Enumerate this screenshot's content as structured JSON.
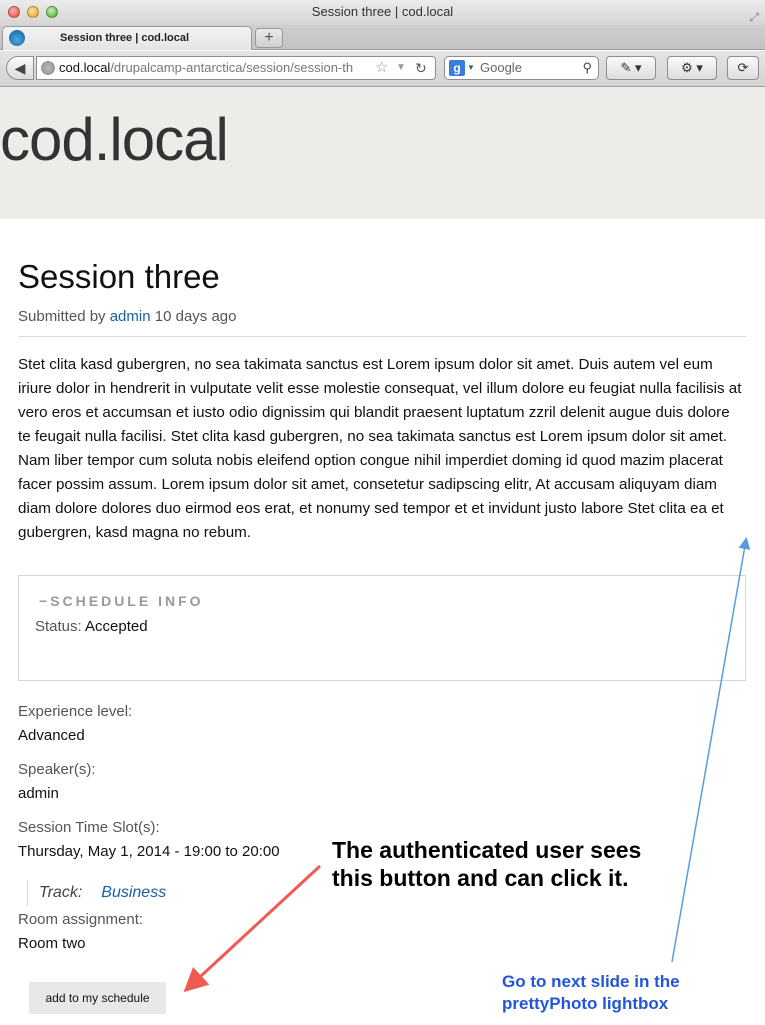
{
  "window": {
    "title": "Session three | cod.local"
  },
  "tab": {
    "title": "Session three | cod.local",
    "new_tab_label": "+"
  },
  "toolbar": {
    "back_label": "◀",
    "url_host": "cod.local",
    "url_path": "/drupalcamp-antarctica/session/session-th",
    "search_placeholder": "Google"
  },
  "site": {
    "name": "cod.local"
  },
  "node": {
    "title": "Session three",
    "submitted_prefix": "Submitted by",
    "author": "admin",
    "submitted_suffix": "10 days ago",
    "body": "Stet clita kasd gubergren, no sea takimata sanctus est Lorem ipsum dolor sit amet. Duis autem vel eum iriure dolor in hendrerit in vulputate velit esse molestie consequat, vel illum dolore eu feugiat nulla facilisis at vero eros et accumsan et iusto odio dignissim qui blandit praesent luptatum zzril delenit augue duis dolore te feugait nulla facilisi. Stet clita kasd gubergren, no sea takimata sanctus est Lorem ipsum dolor sit amet. Nam liber tempor cum soluta nobis eleifend option congue nihil imperdiet doming id quod mazim placerat facer possim assum. Lorem ipsum dolor sit amet, consetetur sadipscing elitr, At accusam aliquyam diam diam dolore dolores duo eirmod eos erat, et nonumy sed tempor et et invidunt justo labore Stet clita ea et gubergren, kasd magna no rebum."
  },
  "schedule": {
    "legend": "SCHEDULE INFO",
    "collapse_glyph": "−",
    "status_label": "Status:",
    "status_value": "Accepted"
  },
  "fields": {
    "experience_label": "Experience level:",
    "experience_value": "Advanced",
    "speakers_label": "Speaker(s):",
    "speakers_value": "admin",
    "timeslot_label": "Session Time Slot(s):",
    "timeslot_value": "Thursday, May 1, 2014 - 19:00 to 20:00",
    "track_label": "Track:",
    "track_value": "Business",
    "room_label": "Room assignment:",
    "room_value": "Room two"
  },
  "actions": {
    "add_to_schedule": "add to my schedule"
  },
  "annotations": {
    "note_line1": "The authenticated user sees",
    "note_line2": "this button and can click it.",
    "next_line1": "Go to next slide in the",
    "next_line2": "prettyPhoto lightbox"
  },
  "colors": {
    "link": "#1a5fa8",
    "arrow_red": "#f05a50",
    "arrow_blue": "#5b9ae0",
    "annotation_blue": "#2255dd"
  }
}
